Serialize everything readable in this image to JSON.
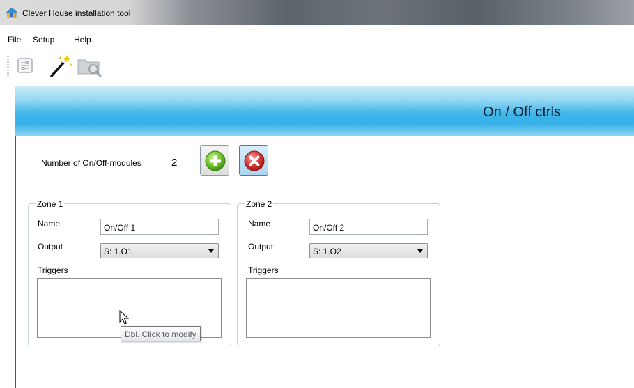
{
  "window": {
    "title": "Clever House installation tool"
  },
  "menu": {
    "items": [
      "File",
      "Setup",
      "Help"
    ]
  },
  "banner": {
    "heading": "On / Off ctrls",
    "color": "#3fb6ea"
  },
  "modules": {
    "label": "Number of On/Off-modules",
    "count": "2"
  },
  "zones": [
    {
      "legend": "Zone 1",
      "name_label": "Name",
      "name_value": "On/Off 1",
      "output_label": "Output",
      "output_value": "S: 1.O1",
      "triggers_label": "Triggers"
    },
    {
      "legend": "Zone 2",
      "name_label": "Name",
      "name_value": "On/Off 2",
      "output_label": "Output",
      "output_value": "S: 1.O2",
      "triggers_label": "Triggers"
    }
  ],
  "tooltip": {
    "text": "Dbl. Click to modify"
  },
  "icons": {
    "app": "house-icon",
    "toolbar": [
      "settings-list-icon",
      "magic-wand-icon",
      "folder-search-icon"
    ],
    "add": "add-circle-icon",
    "remove": "remove-circle-icon"
  }
}
